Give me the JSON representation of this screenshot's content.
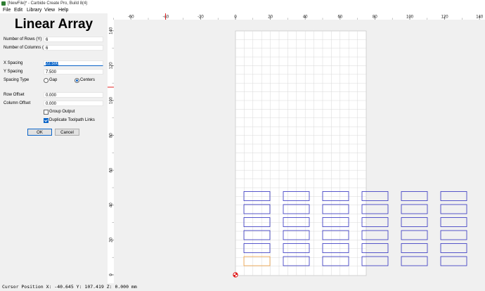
{
  "window": {
    "title": "[NewFile]* - Carbide Create Pro, Build 8(4)"
  },
  "menu": [
    "File",
    "Edit",
    "Library",
    "View",
    "Help"
  ],
  "panel": {
    "title": "Linear Array",
    "rows_label": "Number of Rows (Y)",
    "rows_value": "6",
    "cols_label": "Number of Columns (X)",
    "cols_value": "6",
    "xspacing_label": "X Spacing",
    "xspacing_value": "22.500",
    "yspacing_label": "Y Spacing",
    "yspacing_value": "7.500",
    "spacing_type_label": "Spacing Type",
    "gap_label": "Gap",
    "centers_label": "Centers",
    "row_offset_label": "Row Offset",
    "row_offset_value": "0.000",
    "col_offset_label": "Column Offset",
    "col_offset_value": "0.000",
    "group_output_label": "Group Output",
    "group_output_checked": false,
    "dup_toolpath_label": "Duplicate Toolpath Links",
    "dup_toolpath_checked": true,
    "spacing_type": "Centers",
    "ok_label": "OK",
    "cancel_label": "Cancel"
  },
  "ruler": {
    "h_ticks": [
      "-60",
      "-40",
      "-20",
      "0",
      "20",
      "40",
      "60",
      "80",
      "100",
      "120",
      "140"
    ],
    "v_ticks": [
      "140",
      "120",
      "100",
      "80",
      "60",
      "40",
      "20",
      "0"
    ]
  },
  "design": {
    "array_rows": 6,
    "array_cols": 6,
    "original_color": "#f0a040",
    "copy_color": "#3030c0",
    "grid_color": "#d8d8d8",
    "cursor_marker_color": "#e02020"
  },
  "status": {
    "text": "Cursor Position X: -40.645 Y: 107.419 Z: 0.000 mm"
  }
}
